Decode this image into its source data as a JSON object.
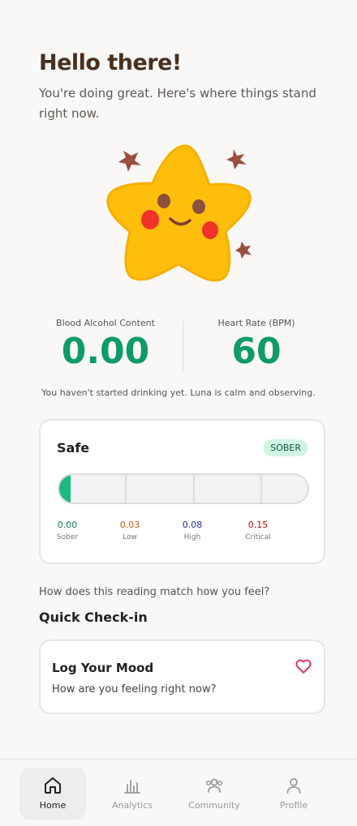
{
  "greeting": {
    "title": "Hello there!",
    "subtitle": "You're doing great. Here's where things stand right now."
  },
  "mascot": {
    "icon": "star-mascot",
    "color": "#ffbe0b"
  },
  "stats": {
    "bac_label": "Blood Alcohol Content",
    "bac_value": "0.00",
    "hr_label": "Heart Rate (BPM)",
    "hr_value": "60",
    "value_color": "#0d9b66"
  },
  "status_note": "You haven't started drinking yet. Luna is calm and observing.",
  "safety": {
    "title": "Safe",
    "badge": "SOBER",
    "meter_fraction": 0.04,
    "scale": [
      {
        "value": "0.00",
        "label": "Sober",
        "color": "#0d8054"
      },
      {
        "value": "0.03",
        "label": "Low",
        "color": "#c45a12"
      },
      {
        "value": "0.08",
        "label": "High",
        "color": "#1e2fa8"
      },
      {
        "value": "0.15",
        "label": "Critical",
        "color": "#b01010"
      }
    ]
  },
  "checkin": {
    "question": "How does this reading match how you feel?",
    "section_title": "Quick Check-in",
    "mood_title": "Log Your Mood",
    "mood_subtitle": "How are you feeling right now?",
    "mood_icon": "heart-icon"
  },
  "nav": {
    "items": [
      {
        "label": "Home",
        "icon": "home-icon",
        "active": true
      },
      {
        "label": "Analytics",
        "icon": "bar-chart-icon",
        "active": false
      },
      {
        "label": "Community",
        "icon": "users-icon",
        "active": false
      },
      {
        "label": "Profile",
        "icon": "user-icon",
        "active": false
      }
    ]
  }
}
